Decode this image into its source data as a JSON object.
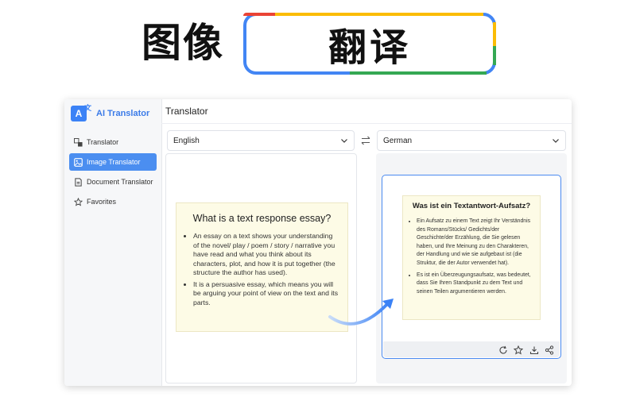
{
  "banner": {
    "title": "图像",
    "highlight": "翻译"
  },
  "app": {
    "brand": "AI Translator",
    "brand_logo": "A",
    "header_title": "Translator",
    "nav": [
      {
        "label": "Translator",
        "icon": "translate-icon"
      },
      {
        "label": "Image Translator",
        "icon": "image-icon"
      },
      {
        "label": "Document Translator",
        "icon": "document-icon"
      },
      {
        "label": "Favorites",
        "icon": "favorites-icon"
      }
    ],
    "source_language": "English",
    "target_language": "German"
  },
  "source_card": {
    "title": "What is a text response essay?",
    "bullets": [
      "An essay on a text shows your understanding of the novel/ play / poem / story / narrative you have read and what you think about its characters, plot, and how it is put together (the structure the author has used).",
      "It is a persuasive essay, which means you will be arguing your point of view on the text and its parts."
    ]
  },
  "translated_card": {
    "title": "Was ist ein Textantwort-Aufsatz?",
    "bullets": [
      "Ein Aufsatz zu einem Text zeigt Ihr Verständnis des Romans/Stücks/ Gedichts/der Geschichte/der Erzählung, die Sie gelesen haben, und Ihre Meinung zu den Charakteren, der Handlung und wie sie aufgebaut ist (die Struktur, die der Autor verwendet hat).",
      "Es ist ein Überzeugungsaufsatz, was bedeutet, dass Sie Ihren Standpunkt zu dem Text und seinen Teilen argumentieren werden."
    ]
  },
  "toolbar_icons": [
    "refresh-icon",
    "star-icon",
    "download-icon",
    "share-icon"
  ],
  "colors": {
    "accent": "#4b8ef0",
    "card_bg": "#fdfbe6",
    "google_blue": "#4285f4",
    "google_red": "#ea4335",
    "google_yellow": "#fbbc05",
    "google_green": "#34a853"
  }
}
